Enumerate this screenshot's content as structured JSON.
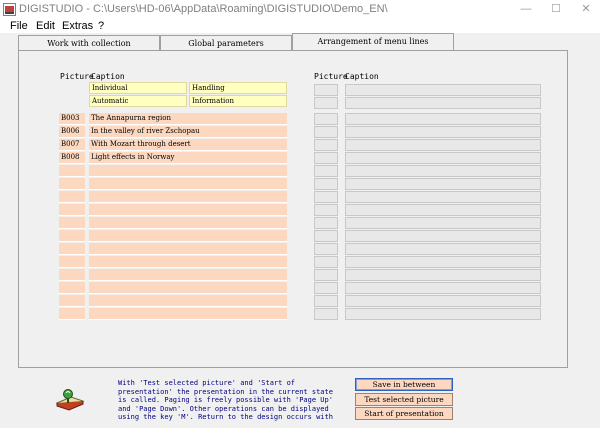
{
  "window": {
    "title": "DIGISTUDIO - C:\\Users\\HD-06\\AppData\\Roaming\\DIGISTUDIO\\Demo_EN\\",
    "minimize": "—",
    "maximize": "☐",
    "close": "✕"
  },
  "menu": {
    "items": [
      "File",
      "Edit",
      "Extras",
      "?"
    ]
  },
  "tabs": [
    {
      "label": "Work with collection"
    },
    {
      "label": "Global parameters"
    },
    {
      "label": "Arrangement of menu lines"
    }
  ],
  "left_grid": {
    "header_picture": "Picture",
    "header_caption": "Caption",
    "options": [
      [
        "Individual",
        "Handling"
      ],
      [
        "Automatic",
        "Information"
      ]
    ],
    "rows": [
      {
        "picture": "B003",
        "caption": "The Annapurna region"
      },
      {
        "picture": "B006",
        "caption": "In the valley of river Zschopau"
      },
      {
        "picture": "B007",
        "caption": "With Mozart through desert"
      },
      {
        "picture": "B008",
        "caption": "Light effects in Norway"
      },
      {
        "picture": "",
        "caption": ""
      },
      {
        "picture": "",
        "caption": ""
      },
      {
        "picture": "",
        "caption": ""
      },
      {
        "picture": "",
        "caption": ""
      },
      {
        "picture": "",
        "caption": ""
      },
      {
        "picture": "",
        "caption": ""
      },
      {
        "picture": "",
        "caption": ""
      },
      {
        "picture": "",
        "caption": ""
      },
      {
        "picture": "",
        "caption": ""
      },
      {
        "picture": "",
        "caption": ""
      },
      {
        "picture": "",
        "caption": ""
      },
      {
        "picture": "",
        "caption": ""
      }
    ]
  },
  "right_grid": {
    "header_picture": "Picture",
    "header_caption": "Caption"
  },
  "info_text": "With 'Test selected picture' and 'Start of presentation' the presentation in the current state is called. Paging is freely possible with 'Page Up' and 'Page Down'. Other operations can be displayed using the key 'M'. Return to the design occurs with",
  "buttons": {
    "save": "Save in between",
    "test": "Test selected picture",
    "start": "Start of presentation"
  },
  "colors": {
    "pink_cell": "#fcd8c0",
    "yellow_cell": "#ffffc0",
    "info_text": "#000080"
  }
}
